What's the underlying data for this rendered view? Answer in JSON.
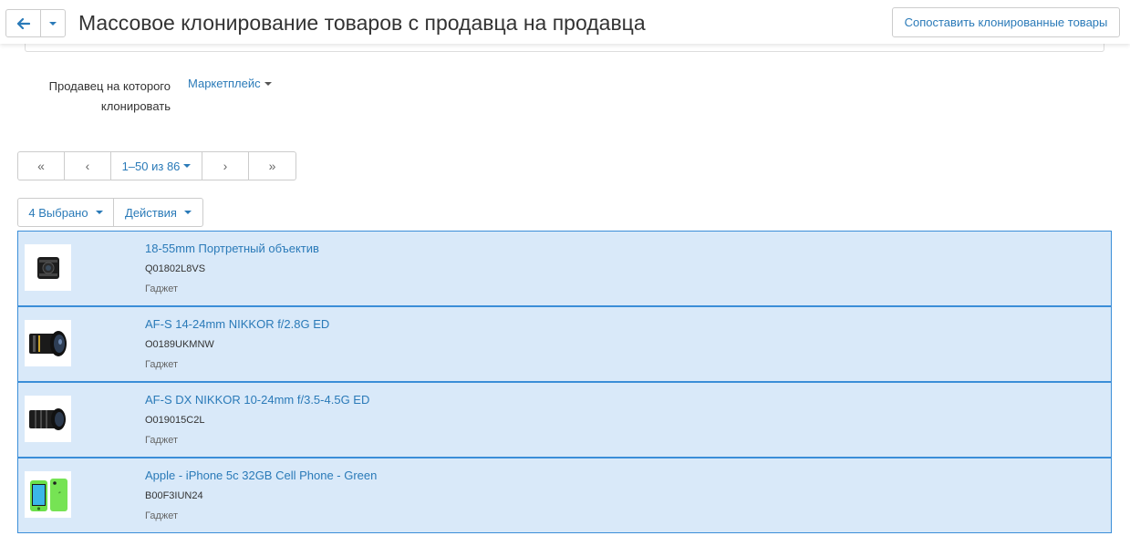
{
  "header": {
    "title": "Массовое клонирование товаров с продавца на продавца",
    "compare_button": "Сопоставить клонированные товары"
  },
  "seller": {
    "label": "Продавец на которого клонировать",
    "value": "Маркетплейс"
  },
  "pagination": {
    "first": "«",
    "prev": "‹",
    "range": "1–50 из 86",
    "next": "›",
    "last": "»"
  },
  "toolbar": {
    "selected": "4 Выбрано",
    "actions": "Действия"
  },
  "products": [
    {
      "name": "18-55mm Портретный объектив",
      "code": "Q01802L8VS",
      "category": "Гаджет",
      "image": "lens-icon"
    },
    {
      "name": "AF-S 14-24mm NIKKOR f/2.8G ED",
      "code": "O0189UKMNW",
      "category": "Гаджет",
      "image": "wide-lens-icon"
    },
    {
      "name": "AF-S DX NIKKOR 10-24mm f/3.5-4.5G ED",
      "code": "O019015C2L",
      "category": "Гаджет",
      "image": "zoom-lens-icon"
    },
    {
      "name": "Apple - iPhone 5c 32GB Cell Phone - Green",
      "code": "B00F3IUN24",
      "category": "Гаджет",
      "image": "phone-icon"
    }
  ],
  "colors": {
    "accent": "#2a7ab8",
    "selected_row_bg": "#d9e9f9",
    "selected_row_border": "#3b8ed8"
  }
}
